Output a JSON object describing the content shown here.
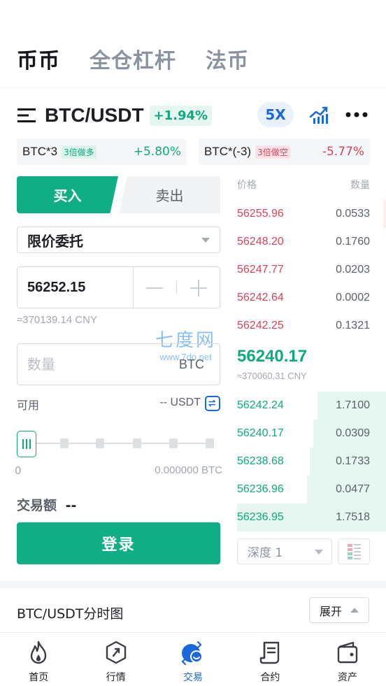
{
  "top_tabs": [
    "币币",
    "全仓杠杆",
    "法币"
  ],
  "pair": {
    "name": "BTC/USDT",
    "change": "+1.94%",
    "leverage": "5X"
  },
  "etfs": [
    {
      "name": "BTC*3",
      "tag": "3倍做多",
      "change": "+5.80%"
    },
    {
      "name": "BTC*(-3)",
      "tag": "3倍做空",
      "change": "-5.77%"
    }
  ],
  "trade": {
    "buy_label": "买入",
    "sell_label": "卖出",
    "order_type": "限价委托",
    "price": "56252.15",
    "price_cny": "≈370139.14 CNY",
    "amount_placeholder": "数量",
    "amount_unit": "BTC",
    "available_label": "可用",
    "available_value": "-- USDT",
    "slider_min": "0",
    "slider_max": "0.000000 BTC",
    "slider_level": 0,
    "total_label": "交易额",
    "total_value": "--",
    "login_label": "登录"
  },
  "order_book": {
    "price_header": "价格",
    "qty_header": "数量",
    "asks": [
      {
        "price": "56255.96",
        "qty": "0.0533",
        "depth": 0.02
      },
      {
        "price": "56248.20",
        "qty": "0.1760",
        "depth": 0.0
      },
      {
        "price": "56247.77",
        "qty": "0.0203",
        "depth": 0.0
      },
      {
        "price": "56242.64",
        "qty": "0.0002",
        "depth": 0.0
      },
      {
        "price": "56242.25",
        "qty": "0.1321",
        "depth": 0.0
      }
    ],
    "last_price": "56240.17",
    "last_price_cny": "≈370060.31 CNY",
    "bids": [
      {
        "price": "56242.24",
        "qty": "1.7100",
        "depth": 0.46
      },
      {
        "price": "56240.17",
        "qty": "0.0309",
        "depth": 0.49
      },
      {
        "price": "56238.68",
        "qty": "0.1733",
        "depth": 0.51
      },
      {
        "price": "56236.96",
        "qty": "0.0477",
        "depth": 0.53
      },
      {
        "price": "56236.95",
        "qty": "1.7518",
        "depth": 1.0
      }
    ],
    "depth_select": "深度 1"
  },
  "watermark": {
    "line1": "七度网",
    "line2": "www.7do.net"
  },
  "chart_section": {
    "title": "BTC/USDT分时图",
    "expand_label": "展开"
  },
  "bottom_nav": [
    {
      "label": "首页",
      "icon": "fire-icon"
    },
    {
      "label": "行情",
      "icon": "market-icon"
    },
    {
      "label": "交易",
      "icon": "trade-icon"
    },
    {
      "label": "合约",
      "icon": "contract-icon"
    },
    {
      "label": "资产",
      "icon": "wallet-icon"
    }
  ],
  "colors": {
    "accent_green": "#0fae84",
    "rise_green": "#0fa981",
    "fall_red": "#d9435a",
    "brand_blue": "#1b69d8"
  }
}
